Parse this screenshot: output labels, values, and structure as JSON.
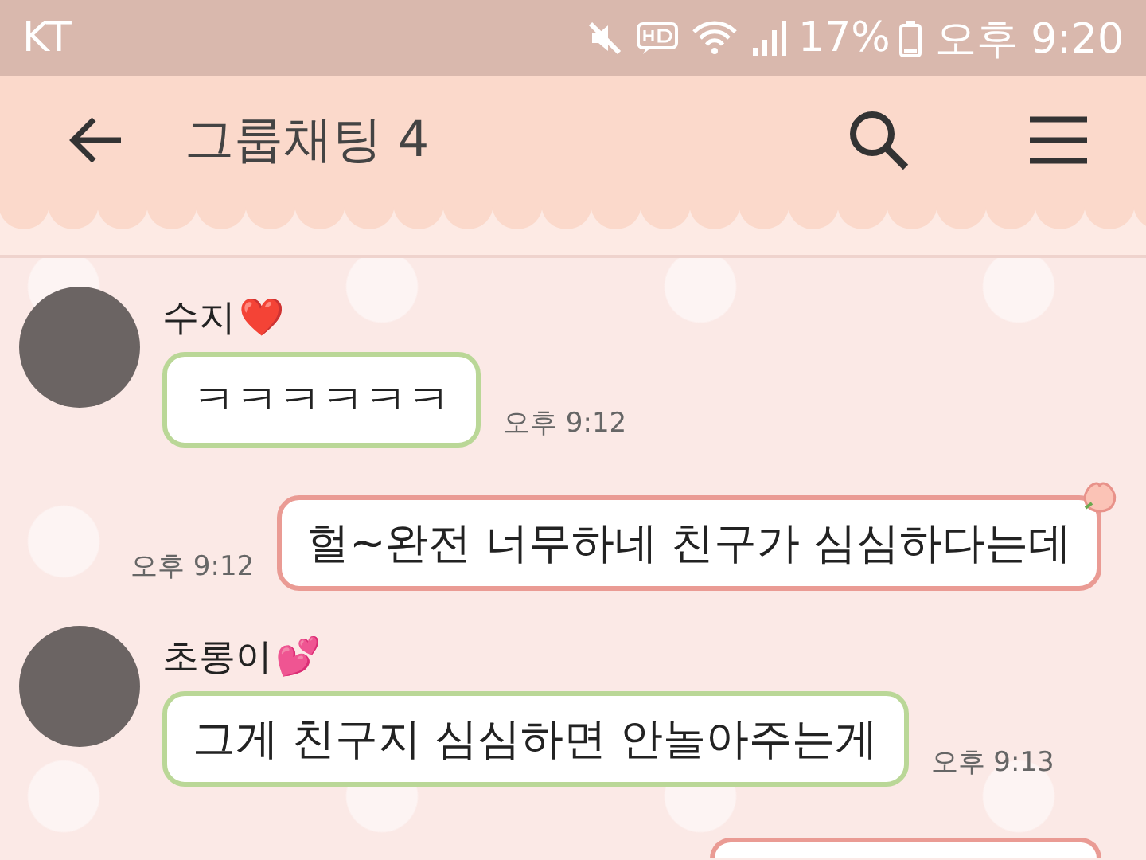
{
  "status_bar": {
    "carrier": "KT",
    "battery": "17%",
    "time": "오후 9:20"
  },
  "header": {
    "title": "그룹채팅 4"
  },
  "messages": [
    {
      "kind": "received",
      "sender": "수지",
      "emoji": "❤️",
      "text": "ㅋㅋㅋㅋㅋㅋ",
      "time": "오후 9:12"
    },
    {
      "kind": "sent",
      "text": "헐~완전 너무하네 친구가 심심하다는데",
      "time": "오후 9:12"
    },
    {
      "kind": "received",
      "sender": "초롱이",
      "emoji": "💕",
      "text": "그게 친구지 심심하면 안놀아주는게",
      "time": "오후 9:13"
    },
    {
      "kind": "sent-cut"
    }
  ]
}
